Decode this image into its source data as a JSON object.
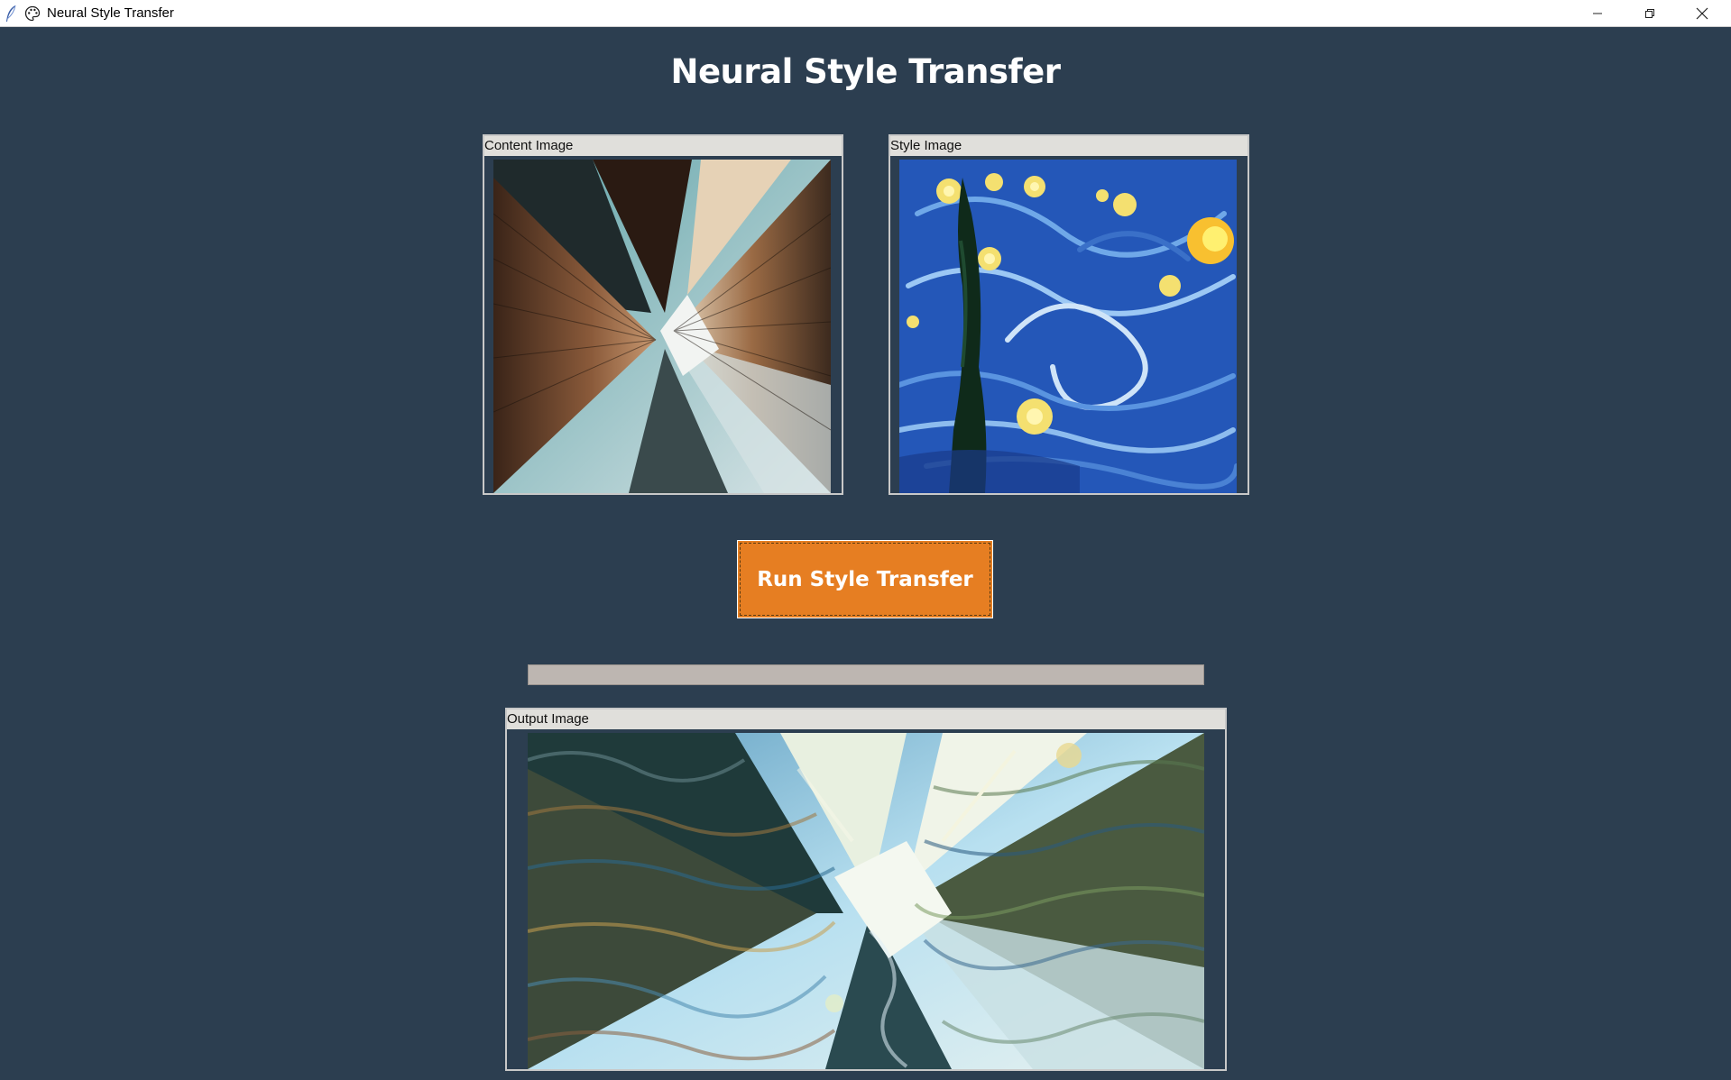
{
  "window": {
    "title": "Neural Style Transfer",
    "controls": [
      "minimize",
      "restore",
      "close"
    ]
  },
  "app": {
    "title": "Neural Style Transfer"
  },
  "content_panel": {
    "label": "Content Image",
    "image": "skyscrapers-upward-view"
  },
  "style_panel": {
    "label": "Style Image",
    "image": "starry-night-painting"
  },
  "run_button": {
    "label": "Run Style Transfer"
  },
  "progress": {
    "value": 0
  },
  "output_panel": {
    "label": "Output Image",
    "image": "stylized-skyscrapers"
  },
  "colors": {
    "background": "#2c3e50",
    "button": "#e67e22",
    "panel_label_bg": "#e0dfdb"
  }
}
